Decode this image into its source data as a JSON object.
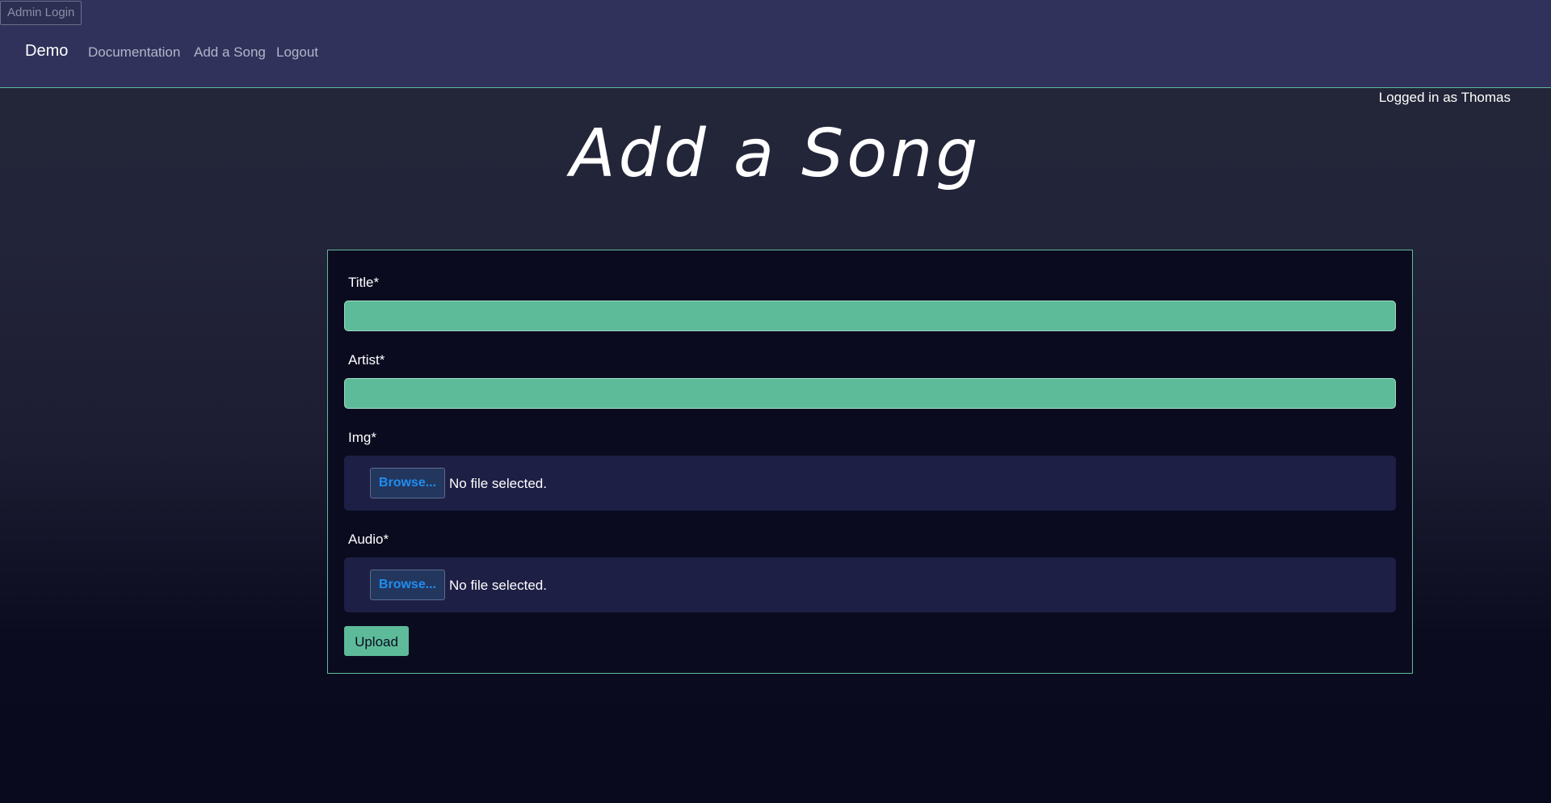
{
  "admin_login": "Admin Login",
  "navbar": {
    "brand": "Demo",
    "links": [
      {
        "label": "Documentation"
      },
      {
        "label": "Add a Song"
      },
      {
        "label": "Logout"
      }
    ]
  },
  "user_status": "Logged in as Thomas",
  "page": {
    "title": "Add a Song"
  },
  "form": {
    "fields": [
      {
        "label": "Title*",
        "value": ""
      },
      {
        "label": "Artist*",
        "value": ""
      }
    ],
    "file_fields": [
      {
        "label": "Img*",
        "button": "Browse...",
        "status": "No file selected."
      },
      {
        "label": "Audio*",
        "button": "Browse...",
        "status": "No file selected."
      }
    ],
    "submit_label": "Upload"
  },
  "colors": {
    "accent": "#5dbb99",
    "navbar_bg": "#30325c",
    "card_bg": "#0b0b20",
    "file_box_bg": "#1e1f45",
    "browse_text": "#1f8ef1"
  }
}
